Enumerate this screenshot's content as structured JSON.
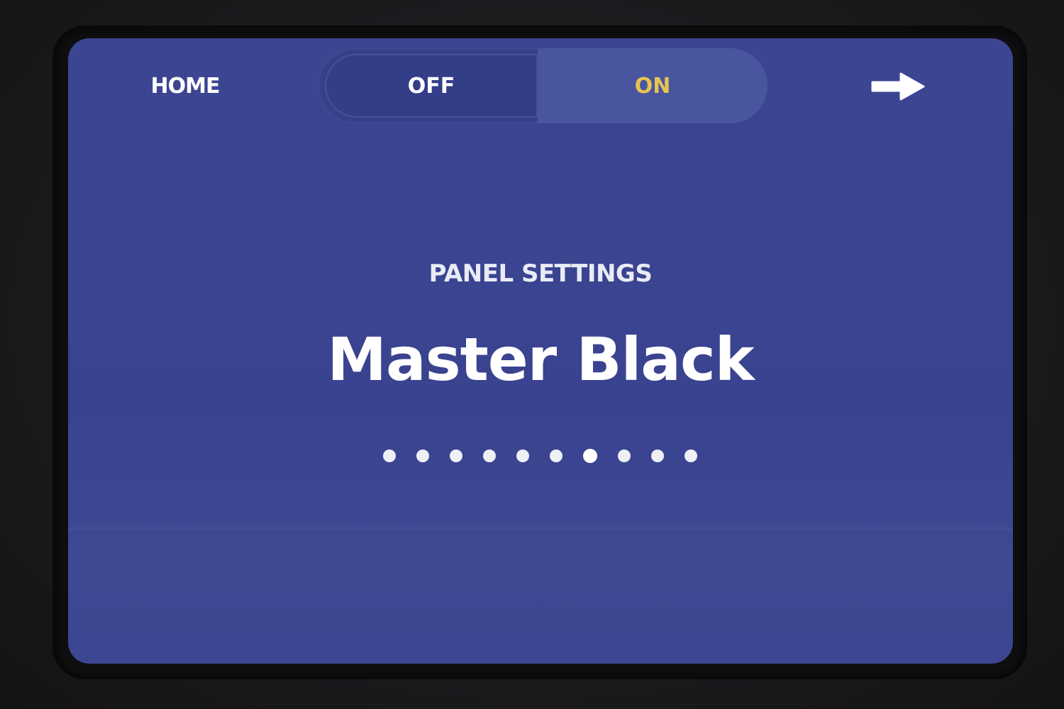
{
  "header": {
    "home_label": "HOME",
    "toggle": {
      "off_label": "OFF",
      "on_label": "ON",
      "selected": "ON"
    },
    "next_icon": "arrow-right-icon"
  },
  "main": {
    "section_label": "PANEL SETTINGS",
    "current_setting": "Master Black"
  },
  "pagination": {
    "total_pages": 10,
    "current_page": 7
  },
  "colors": {
    "screen_background": "#3b4591",
    "active_toggle_text": "#e6c451",
    "text": "#ffffff"
  }
}
